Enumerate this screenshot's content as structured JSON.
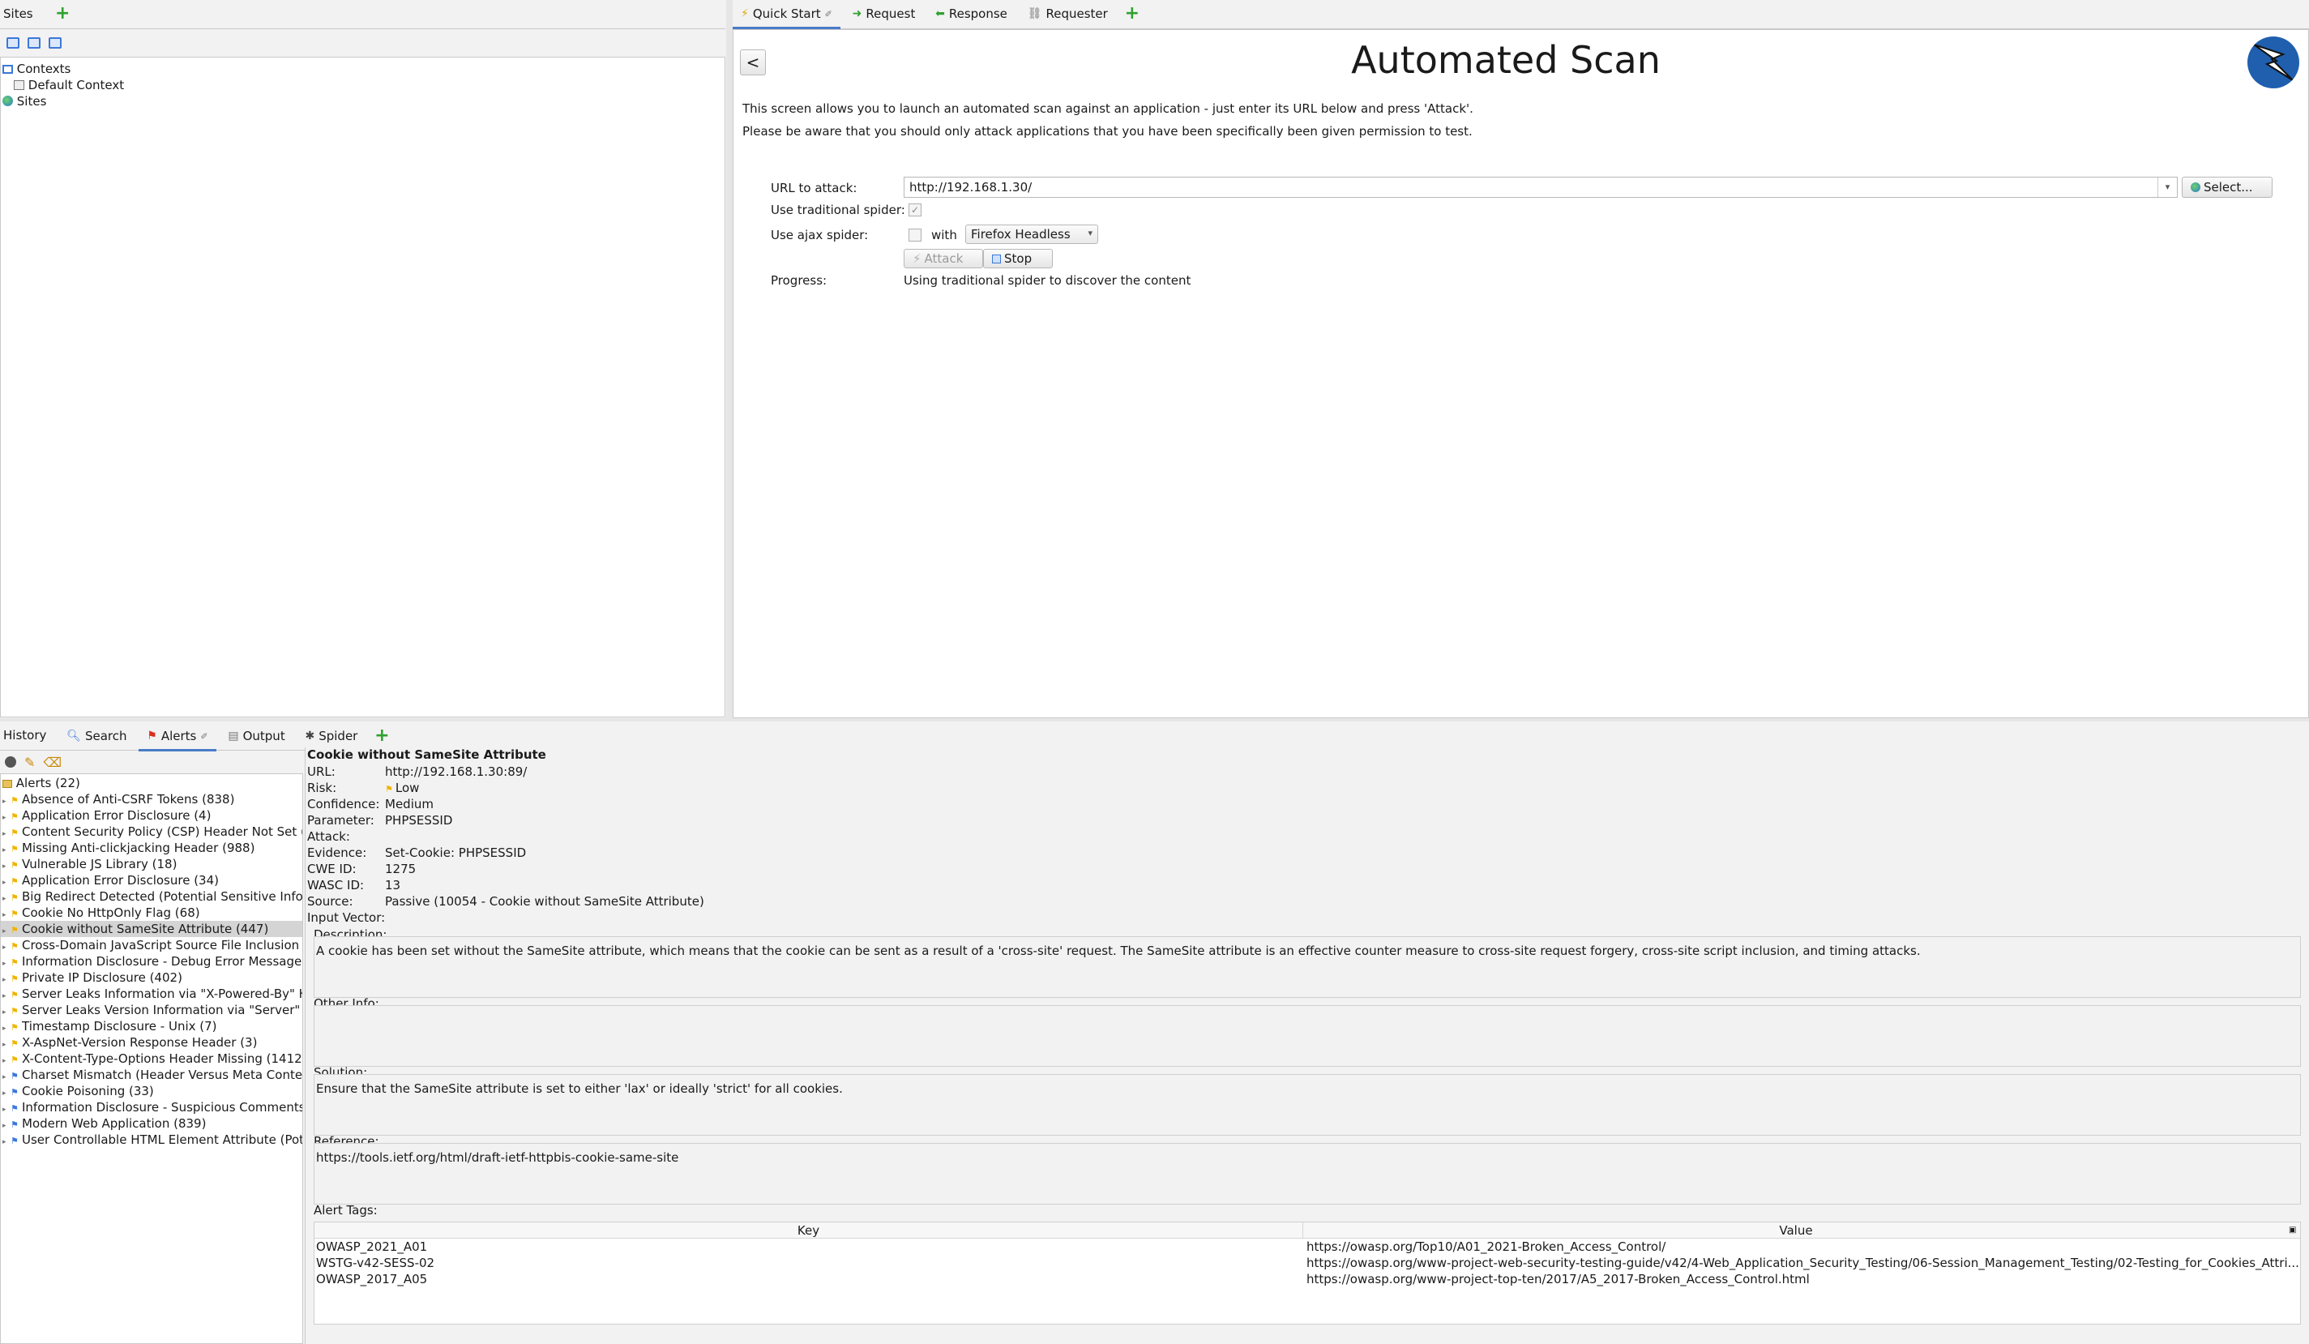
{
  "top_tabs_left": {
    "sites_label": "Sites"
  },
  "top_tabs_right": [
    {
      "label": "Quick Start",
      "icon": "lightning-icon",
      "active": true
    },
    {
      "label": "Request",
      "icon": "arrow-right-icon"
    },
    {
      "label": "Response",
      "icon": "arrow-left-icon"
    },
    {
      "label": "Requester",
      "icon": "link-icon"
    }
  ],
  "sites_tree": {
    "contexts": "Contexts",
    "default_context": "Default Context",
    "sites": "Sites"
  },
  "quick_start": {
    "back_label": "<",
    "title": "Automated Scan",
    "intro_1": "This screen allows you to launch an automated scan against  an application - just enter its URL below and press 'Attack'.",
    "intro_2": "Please be aware that you should only attack applications that you have been specifically been given permission to test.",
    "url_label": "URL to attack:",
    "url_value": "http://192.168.1.30/",
    "select_label": "Select...",
    "traditional_label": "Use traditional spider:",
    "traditional_checked": true,
    "ajax_label": "Use ajax spider:",
    "ajax_checked": false,
    "with_label": "with",
    "browser_value": "Firefox Headless",
    "attack_label": "Attack",
    "stop_label": "Stop",
    "progress_label": "Progress:",
    "progress_value": "Using traditional spider to discover the content"
  },
  "bottom_tabs": [
    {
      "label": "History",
      "icon": ""
    },
    {
      "label": "Search",
      "icon": "search-icon"
    },
    {
      "label": "Alerts",
      "icon": "flag-icon",
      "active": true
    },
    {
      "label": "Output",
      "icon": "document-icon"
    },
    {
      "label": "Spider",
      "icon": "spider-icon"
    }
  ],
  "alerts": {
    "root": "Alerts (22)",
    "items": [
      {
        "label": "Absence of Anti-CSRF Tokens (838)",
        "risk": "low"
      },
      {
        "label": "Application Error Disclosure (4)",
        "risk": "low"
      },
      {
        "label": "Content Security Policy (CSP) Header Not Set (",
        "risk": "low"
      },
      {
        "label": "Missing Anti-clickjacking Header (988)",
        "risk": "low"
      },
      {
        "label": "Vulnerable JS Library (18)",
        "risk": "low"
      },
      {
        "label": "Application Error Disclosure (34)",
        "risk": "low"
      },
      {
        "label": "Big Redirect Detected (Potential Sensitive Inforr",
        "risk": "low"
      },
      {
        "label": "Cookie No HttpOnly Flag (68)",
        "risk": "low"
      },
      {
        "label": "Cookie without SameSite Attribute (447)",
        "risk": "low",
        "selected": true
      },
      {
        "label": "Cross-Domain JavaScript Source File Inclusion (8",
        "risk": "low"
      },
      {
        "label": "Information Disclosure - Debug Error Messages",
        "risk": "low"
      },
      {
        "label": "Private IP Disclosure (402)",
        "risk": "low"
      },
      {
        "label": "Server Leaks Information via \"X-Powered-By\" HT",
        "risk": "low"
      },
      {
        "label": "Server Leaks Version Information via \"Server\" H",
        "risk": "low"
      },
      {
        "label": "Timestamp Disclosure - Unix (7)",
        "risk": "low"
      },
      {
        "label": "X-AspNet-Version Response Header (3)",
        "risk": "low"
      },
      {
        "label": "X-Content-Type-Options Header Missing (1412)",
        "risk": "low"
      },
      {
        "label": "Charset Mismatch (Header Versus Meta Conter",
        "risk": "info"
      },
      {
        "label": "Cookie Poisoning (33)",
        "risk": "info"
      },
      {
        "label": "Information Disclosure - Suspicious Comments",
        "risk": "info"
      },
      {
        "label": "Modern Web Application (839)",
        "risk": "info"
      },
      {
        "label": "User Controllable HTML Element Attribute (Pote",
        "risk": "info"
      }
    ]
  },
  "detail": {
    "title": "Cookie without SameSite Attribute",
    "fields": [
      {
        "key": "URL:",
        "value": "http://192.168.1.30:89/"
      },
      {
        "key": "Risk:",
        "value": "Low"
      },
      {
        "key": "Confidence:",
        "value": "Medium"
      },
      {
        "key": "Parameter:",
        "value": "PHPSESSID"
      },
      {
        "key": "Attack:",
        "value": ""
      },
      {
        "key": "Evidence:",
        "value": "Set-Cookie: PHPSESSID"
      },
      {
        "key": "CWE ID:",
        "value": "1275"
      },
      {
        "key": "WASC ID:",
        "value": "13"
      },
      {
        "key": "Source:",
        "value": "Passive (10054 - Cookie without SameSite Attribute)"
      },
      {
        "key": "Input Vector:",
        "value": ""
      }
    ],
    "description_label": "Description:",
    "description": "A cookie has been set without the SameSite attribute, which means that the cookie can be sent as a result of a 'cross-site' request. The SameSite attribute is an effective counter measure to cross-site request forgery, cross-site script inclusion, and timing attacks.",
    "other_info_label": "Other Info:",
    "other_info": "",
    "solution_label": "Solution:",
    "solution": "Ensure that the SameSite attribute is set to either 'lax' or ideally 'strict' for all cookies.",
    "reference_label": "Reference:",
    "reference": "https://tools.ietf.org/html/draft-ietf-httpbis-cookie-same-site",
    "tags_label": "Alert Tags:",
    "tags_header_key": "Key",
    "tags_header_value": "Value",
    "tags": [
      {
        "key": "OWASP_2021_A01",
        "value": "https://owasp.org/Top10/A01_2021-Broken_Access_Control/"
      },
      {
        "key": "WSTG-v42-SESS-02",
        "value": "https://owasp.org/www-project-web-security-testing-guide/v42/4-Web_Application_Security_Testing/06-Session_Management_Testing/02-Testing_for_Cookies_Attri..."
      },
      {
        "key": "OWASP_2017_A05",
        "value": "https://owasp.org/www-project-top-ten/2017/A5_2017-Broken_Access_Control.html"
      }
    ]
  },
  "colors": {
    "accent": "#4a7bc8",
    "risk_low": "#f0b400",
    "risk_info": "#3b78d8",
    "add_green": "#2fa12f",
    "selected_row": "#d4d4d4"
  }
}
